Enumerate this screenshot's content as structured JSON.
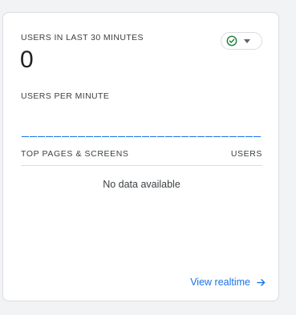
{
  "card": {
    "users_label": "USERS IN LAST 30 MINUTES",
    "user_count": "0",
    "status_icon": "check-circle-icon",
    "status_color": "#188038",
    "per_minute_label": "USERS PER MINUTE",
    "per_minute_values": [
      0,
      0,
      0,
      0,
      0,
      0,
      0,
      0,
      0,
      0,
      0,
      0,
      0,
      0,
      0,
      0,
      0,
      0,
      0,
      0,
      0,
      0,
      0,
      0,
      0,
      0,
      0,
      0,
      0,
      0
    ],
    "bar_color": "#1a73e8",
    "table": {
      "col_pages": "TOP PAGES & SCREENS",
      "col_users": "USERS",
      "empty_text": "No data available"
    },
    "link": {
      "label": "View realtime",
      "icon": "arrow-right-icon",
      "color": "#1a73e8"
    }
  }
}
